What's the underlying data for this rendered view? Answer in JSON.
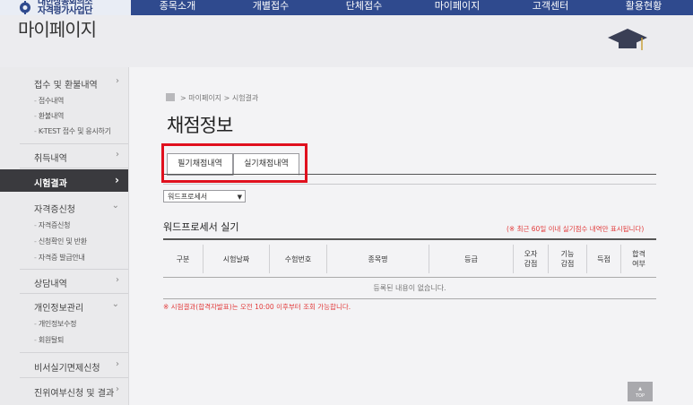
{
  "header": {
    "logo_line1": "대한상공회의소",
    "logo_line2": "자격평가사업단",
    "nav": [
      "종목소개",
      "개별접수",
      "단체접수",
      "마이페이지",
      "고객센터",
      "활용현황"
    ]
  },
  "page_heading": "마이페이지",
  "sidebar": {
    "menus": [
      {
        "label": "접수 및 환불내역",
        "subs": [
          "접수내역",
          "환불내역",
          "K-TEST 접수 및 응시하기"
        ]
      },
      {
        "label": "취득내역",
        "subs": []
      },
      {
        "label": "시험결과",
        "subs": []
      },
      {
        "label": "자격증신청",
        "subs": [
          "자격증신청",
          "신청확인 및 반환",
          "자격증 발급안내"
        ]
      },
      {
        "label": "상담내역",
        "subs": []
      },
      {
        "label": "개인정보관리",
        "subs": [
          "개인정보수정",
          "회원탈퇴"
        ]
      },
      {
        "label": "비서실기면제신청",
        "subs": []
      },
      {
        "label": "진위여부신청 및 결과",
        "subs": []
      }
    ]
  },
  "breadcrumb": "> 마이페이지 > 시험결과",
  "title": "채점정보",
  "tabs": [
    "필기채점내역",
    "실기채점내역"
  ],
  "select": {
    "value": "워드프로세서"
  },
  "section_title": "워드프로세서 실기",
  "notice": "(※ 최근 60일 이내 실기점수 내역만 표시됩니다)",
  "table": {
    "headers": [
      "구분",
      "시험날짜",
      "수험번호",
      "종목명",
      "등급",
      "오자\n감점",
      "기능\n감점",
      "득점",
      "합격\n여부"
    ],
    "empty_message": "등록된 내용이 없습니다."
  },
  "footnote": "※ 시험결과(합격자발표)는 오전 10:00 이후부터 조회 가능합니다.",
  "top_button": "TOP",
  "colors": {
    "nav": "#2f4a8e",
    "highlight": "#e0101e",
    "notice": "#e23a3a",
    "active_menu": "#3a3a3e"
  }
}
